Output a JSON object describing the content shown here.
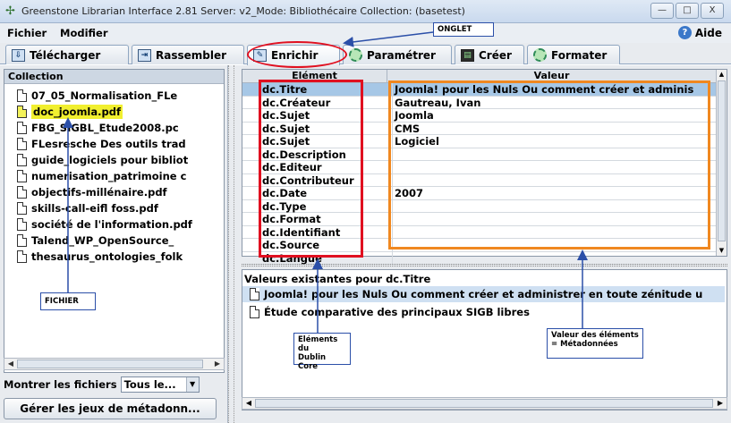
{
  "window": {
    "title": "Greenstone Librarian Interface 2.81  Server: v2_Mode: Bibliothécaire  Collection: (basetest)",
    "minimize": "—",
    "maximize": "□",
    "close": "X"
  },
  "menu": {
    "file": "Fichier",
    "edit": "Modifier",
    "help": "Aide"
  },
  "tabs": [
    {
      "label": "Télécharger"
    },
    {
      "label": "Rassembler"
    },
    {
      "label": "Enrichir"
    },
    {
      "label": "Paramétrer"
    },
    {
      "label": "Créer"
    },
    {
      "label": "Formater"
    }
  ],
  "collection": {
    "header": "Collection",
    "files": [
      "07_05_Normalisation_FLe",
      "doc_joomla.pdf",
      "FBG_SIGBL_Etude2008.pc",
      "FLesresche Des outils trad",
      "guide_logiciels pour bibliot",
      "numerisation_patrimoine c",
      "objectifs-millénaire.pdf",
      "skills-call-eifl foss.pdf",
      "société de l'information.pdf",
      "Talend_WP_OpenSource_",
      "thesaurus_ontologies_folk"
    ],
    "selected_index": 1,
    "show_files_label": "Montrer les fichiers",
    "show_files_value": "Tous le...",
    "manage_button": "Gérer les jeux de métadonn..."
  },
  "metadata_table": {
    "col_element": "Elément",
    "col_value": "Valeur",
    "rows": [
      {
        "element": "dc.Titre",
        "value": "Joomla! pour les Nuls Ou comment créer et adminis"
      },
      {
        "element": "dc.Créateur",
        "value": "Gautreau, Ivan"
      },
      {
        "element": "dc.Sujet",
        "value": "Joomla"
      },
      {
        "element": "dc.Sujet",
        "value": "CMS"
      },
      {
        "element": "dc.Sujet",
        "value": "Logiciel"
      },
      {
        "element": "dc.Description",
        "value": ""
      },
      {
        "element": "dc.Editeur",
        "value": ""
      },
      {
        "element": "dc.Contributeur",
        "value": ""
      },
      {
        "element": "dc.Date",
        "value": "2007"
      },
      {
        "element": "dc.Type",
        "value": ""
      },
      {
        "element": "dc.Format",
        "value": ""
      },
      {
        "element": "dc.Identifiant",
        "value": ""
      },
      {
        "element": "dc.Source",
        "value": ""
      },
      {
        "element": "dc.Langue",
        "value": ""
      }
    ],
    "selected_index": 0
  },
  "existing_values": {
    "title": "Valeurs existantes pour dc.Titre",
    "items": [
      "Joomla! pour les Nuls Ou comment créer et administrer en toute zénitude u",
      "Étude comparative des principaux SIGB libres"
    ]
  },
  "annotations": {
    "onglet": "ONGLET",
    "fichier": "FICHIER",
    "dublin_core": "Eléments du\nDublin Core",
    "metadonnees": "Valeur des éléments\n= Métadonnées"
  },
  "colors": {
    "annotation_red": "#e01020",
    "annotation_orange": "#f08820",
    "annotation_blue": "#2b4fa8",
    "selection_yellow": "#f1ef2f",
    "selection_blue": "#a6c7e6"
  }
}
